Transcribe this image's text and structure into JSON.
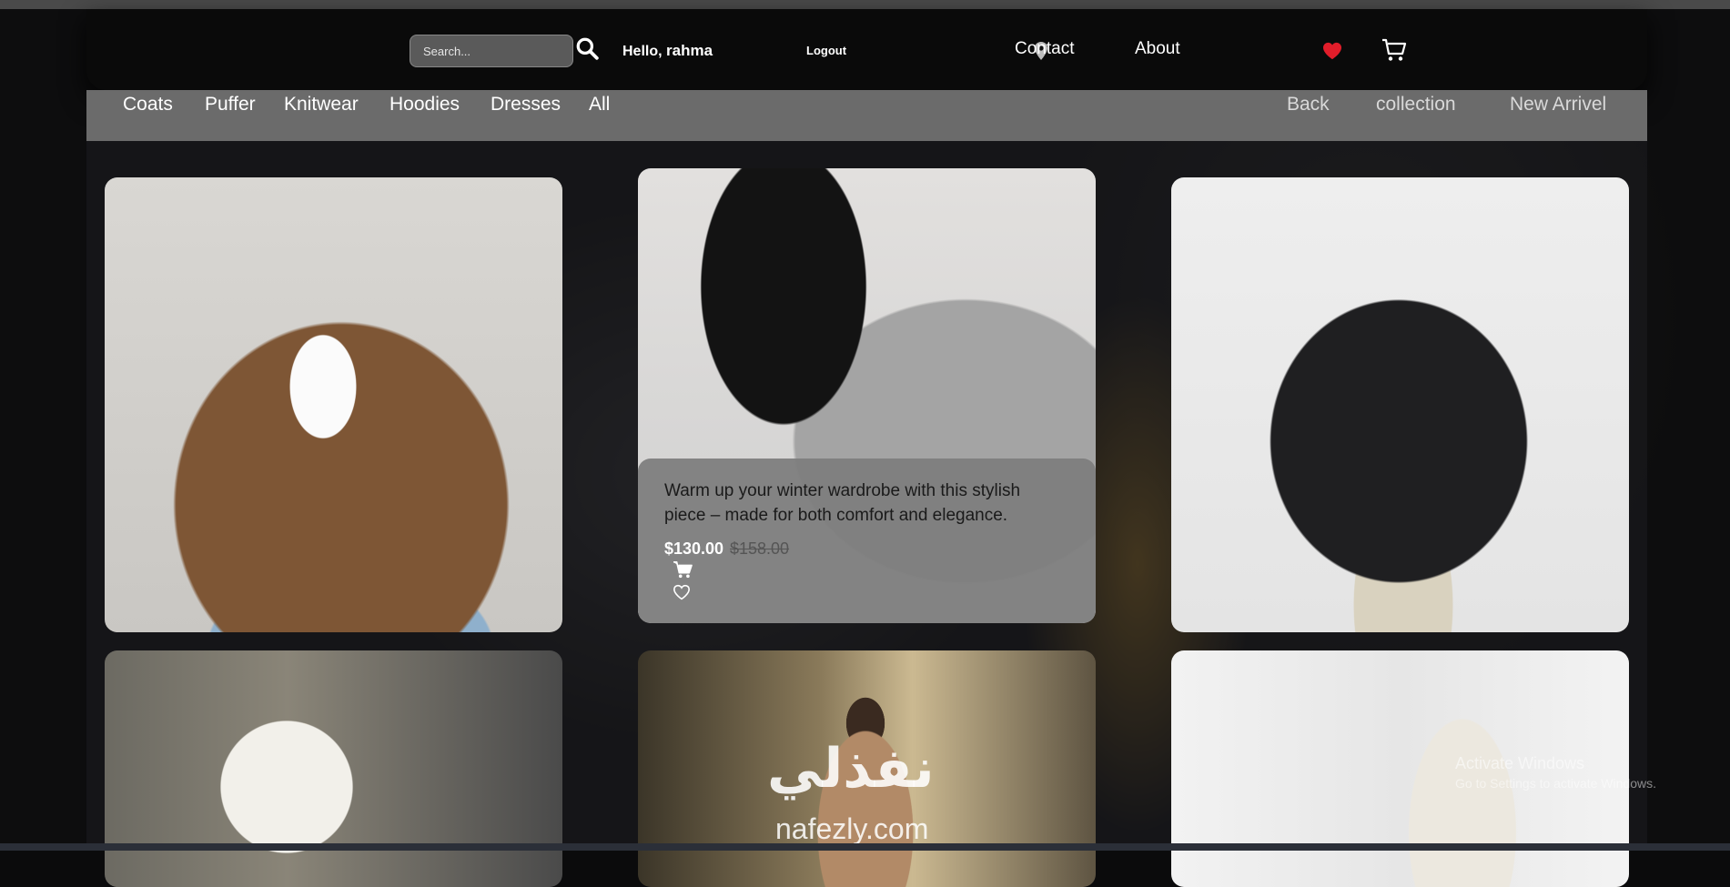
{
  "header": {
    "search_placeholder": "Search...",
    "greeting_prefix": "Hello,",
    "username": "rahma",
    "logout_label": "Logout",
    "contact_label": "Contact",
    "about_label": "About"
  },
  "categories": {
    "left": [
      "Coats",
      "Puffer",
      "Knitwear",
      "Hoodies",
      "Dresses",
      "All"
    ],
    "right": [
      "Back",
      "collection",
      "New Arrivel"
    ]
  },
  "featured_product": {
    "description": "Warm up your winter wardrobe with this stylish piece – made for both comfort and elegance.",
    "price": "$130.00",
    "old_price": "$158.00"
  },
  "watermarks": {
    "arabic_logo": "نفذلي",
    "site": "nafezly.com",
    "activate_title": "Activate Windows",
    "activate_sub": "Go to Settings to activate Windows."
  },
  "colors": {
    "accent_heart": "#e11d2a",
    "category_bar": "#6b6b6b",
    "overlay": "#7d7d7d"
  },
  "icons": [
    "search-icon",
    "location-icon",
    "heart-icon",
    "cart-icon"
  ]
}
